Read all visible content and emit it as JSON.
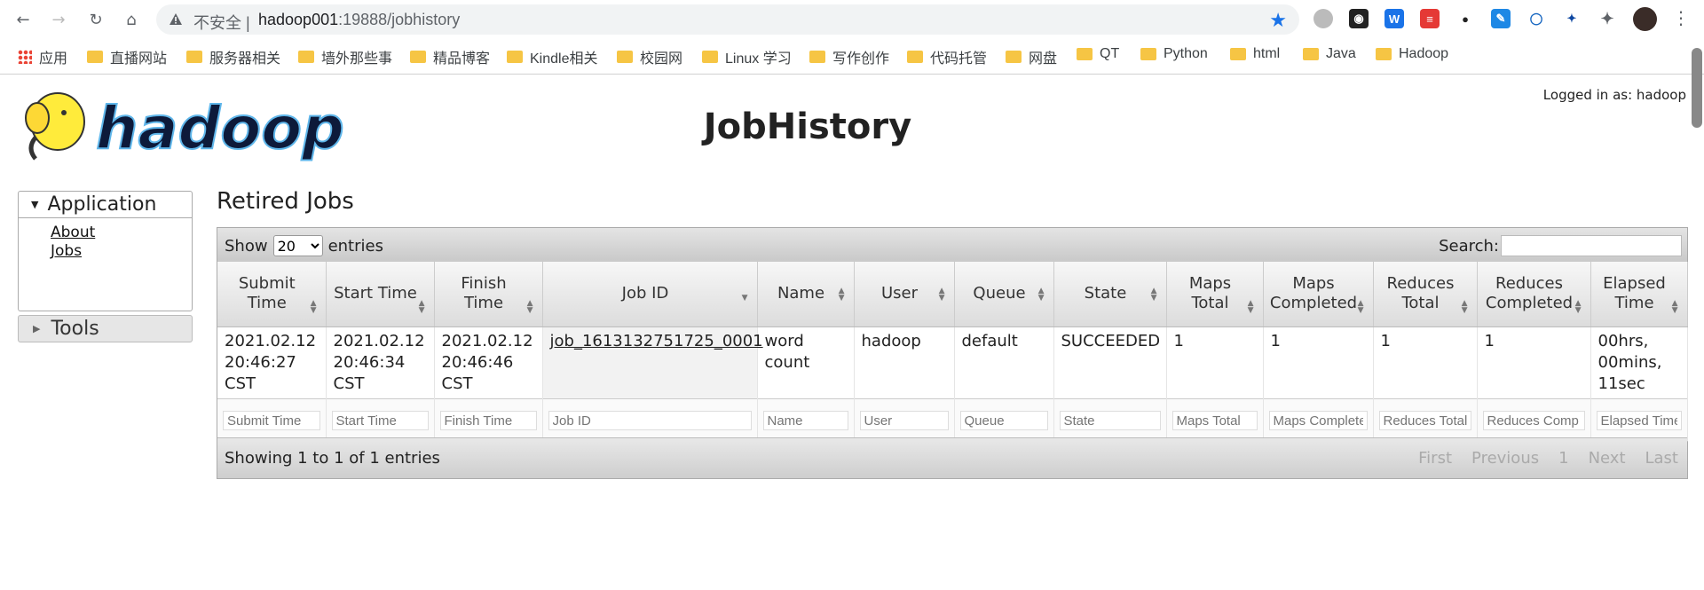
{
  "browser": {
    "insecure_label": "不安全",
    "url_host": "hadoop001",
    "url_path": ":19888/jobhistory"
  },
  "bookmarks": [
    "应用",
    "直播网站",
    "服务器相关",
    "墙外那些事",
    "精品博客",
    "Kindle相关",
    "校园网",
    "Linux 学习",
    "写作创作",
    "代码托管",
    "网盘",
    "QT",
    "Python",
    "html",
    "Java",
    "Hadoop"
  ],
  "header": {
    "logo_text": "hadoop",
    "title": "JobHistory",
    "logged_in": "Logged in as: hadoop"
  },
  "sidebar": {
    "application_title": "Application",
    "links": [
      "About",
      "Jobs"
    ],
    "tools_title": "Tools"
  },
  "main": {
    "section_title": "Retired Jobs",
    "show_label": "Show",
    "entries_label": "entries",
    "page_size": "20",
    "search_label": "Search:",
    "columns": [
      "Submit Time",
      "Start Time",
      "Finish Time",
      "Job ID",
      "Name",
      "User",
      "Queue",
      "State",
      "Maps Total",
      "Maps Completed",
      "Reduces Total",
      "Reduces Completed",
      "Elapsed Time"
    ],
    "rows": [
      {
        "submit_time": "2021.02.12 20:46:27 CST",
        "start_time": "2021.02.12 20:46:34 CST",
        "finish_time": "2021.02.12 20:46:46 CST",
        "job_id": "job_1613132751725_0001",
        "name": "word count",
        "user": "hadoop",
        "queue": "default",
        "state": "SUCCEEDED",
        "maps_total": "1",
        "maps_completed": "1",
        "reduces_total": "1",
        "reduces_completed": "1",
        "elapsed": "00hrs, 00mins, 11sec"
      }
    ],
    "filter_placeholders": [
      "Submit Time",
      "Start Time",
      "Finish Time",
      "Job ID",
      "Name",
      "User",
      "Queue",
      "State",
      "Maps Total",
      "Maps Complete",
      "Reduces Total",
      "Reduces Comp",
      "Elapsed Time"
    ],
    "info": "Showing 1 to 1 of 1 entries",
    "pager": {
      "first": "First",
      "previous": "Previous",
      "page": "1",
      "next": "Next",
      "last": "Last"
    }
  }
}
